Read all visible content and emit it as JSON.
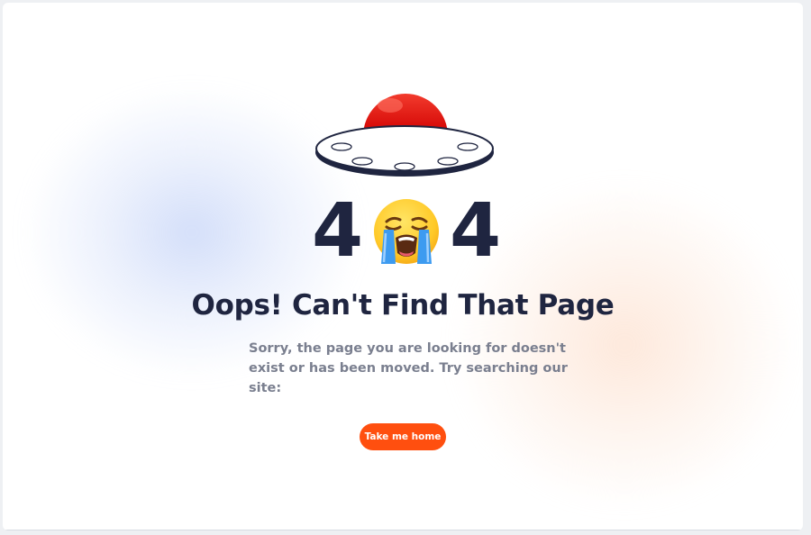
{
  "error": {
    "code_left": "4",
    "code_right": "4",
    "emoji_icon": "loudly-crying-face-icon",
    "title": "Oops! Can't Find That Page",
    "description": "Sorry, the page you are looking for doesn't exist or has been moved. Try searching our site:"
  },
  "actions": {
    "home_label": "Take me home"
  },
  "colors": {
    "accent": "#ff4f0f",
    "heading": "#1f2540",
    "body_text": "#7a7f8f",
    "ufo_dome": "#e10707"
  }
}
